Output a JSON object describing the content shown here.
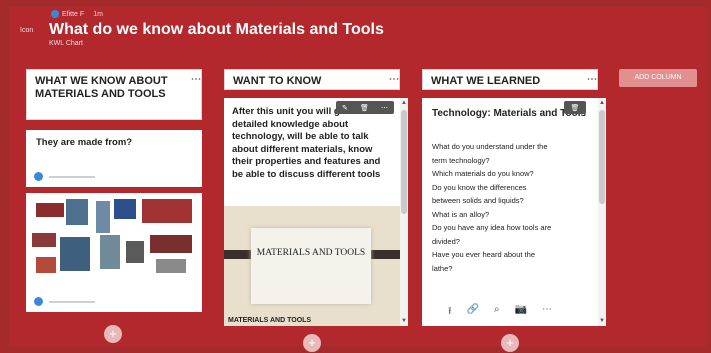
{
  "header": {
    "author": "Efitte F",
    "time": "1m",
    "icon_label": "Icon",
    "title": "What do we know about Materials and Tools",
    "subtitle": "KWL Chart"
  },
  "columns": [
    {
      "title": "WHAT WE KNOW ABOUT MATERIALS AND TOOLS"
    },
    {
      "title": "WANT TO KNOW"
    },
    {
      "title": "WHAT WE LEARNED"
    }
  ],
  "add_column_label": "ADD COLUMN",
  "col1": {
    "card1_question": "They are made from?"
  },
  "col2": {
    "body": "After this unit you will get more detailed knowledge about technology, will be able to talk about different materials, know their properties and features and be able to discuss different tools",
    "image_title": "MATERIALS AND TOOLS",
    "image_caption": "MATERIALS AND TOOLS"
  },
  "col3": {
    "title": "Technology: Materials and Tools",
    "lines": [
      "What do you understand under the",
      "term technology?",
      "Which materials do you know?",
      "Do you know the differences",
      "between solids and liquids?",
      "What is an alloy?",
      "Do you have any idea how tools are",
      "divided?",
      "Have you ever heard about the",
      "lathe?"
    ]
  },
  "plus_label": "+",
  "colors": {
    "background": "#b3282d",
    "card": "#ffffff",
    "accent": "#3b88d9"
  }
}
